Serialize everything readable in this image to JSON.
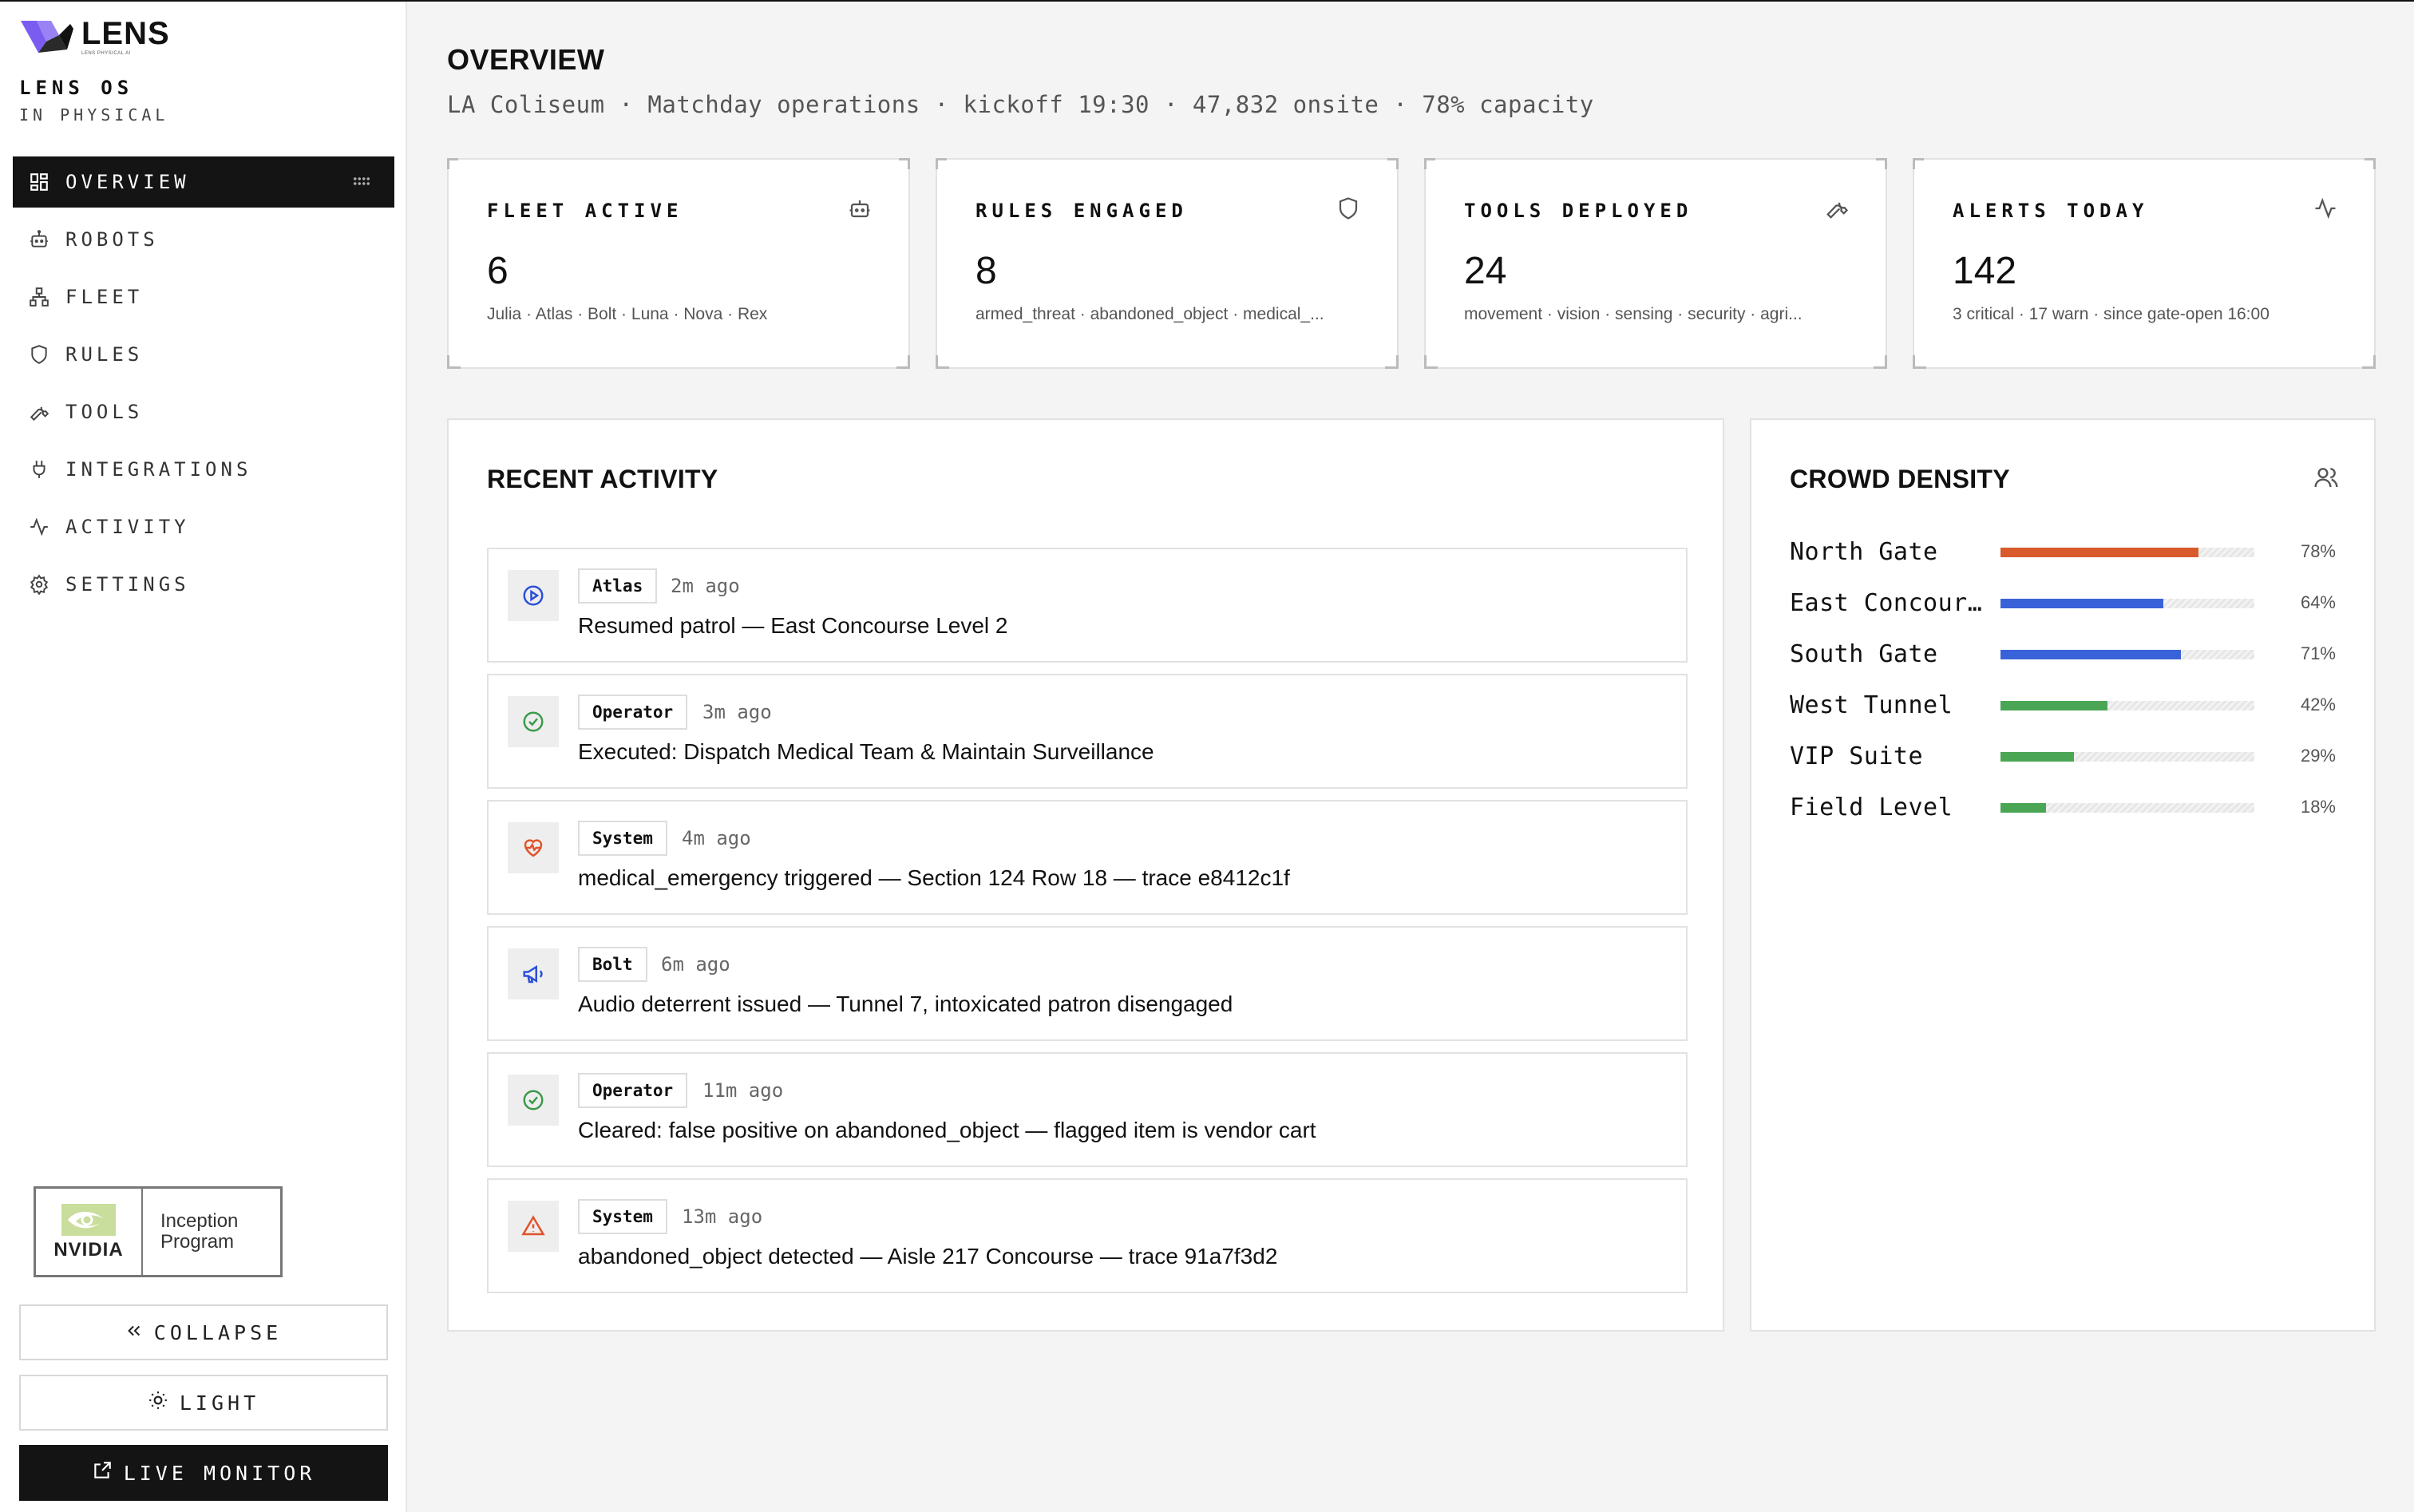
{
  "brand": {
    "logo_text": "LENS",
    "logo_sub": "LENS PHYSICAL AI",
    "os_title": "LENS OS",
    "os_sub": "IN PHYSICAL"
  },
  "nav": [
    {
      "label": "OVERVIEW",
      "icon": "layout-grid-icon",
      "active": true
    },
    {
      "label": "ROBOTS",
      "icon": "robot-icon"
    },
    {
      "label": "FLEET",
      "icon": "network-icon"
    },
    {
      "label": "RULES",
      "icon": "shield-icon"
    },
    {
      "label": "TOOLS",
      "icon": "wrench-icon"
    },
    {
      "label": "INTEGRATIONS",
      "icon": "plug-icon"
    },
    {
      "label": "ACTIVITY",
      "icon": "activity-icon"
    },
    {
      "label": "SETTINGS",
      "icon": "gear-icon"
    }
  ],
  "partner": {
    "name": "NVIDIA",
    "program_line1": "Inception",
    "program_line2": "Program"
  },
  "sidebar_buttons": {
    "collapse": "COLLAPSE",
    "theme": "LIGHT",
    "live_monitor": "LIVE MONITOR"
  },
  "header": {
    "title": "OVERVIEW",
    "subtitle": "LA Coliseum · Matchday operations · kickoff 19:30 · 47,832 onsite · 78% capacity"
  },
  "stats": [
    {
      "label": "FLEET ACTIVE",
      "value": "6",
      "detail": "Julia · Atlas · Bolt · Luna · Nova · Rex",
      "icon": "robot-icon"
    },
    {
      "label": "RULES ENGAGED",
      "value": "8",
      "detail": "armed_threat · abandoned_object · medical_...",
      "icon": "shield-icon"
    },
    {
      "label": "TOOLS DEPLOYED",
      "value": "24",
      "detail": "movement · vision · sensing · security · agri...",
      "icon": "wrench-icon"
    },
    {
      "label": "ALERTS TODAY",
      "value": "142",
      "detail": "3 critical · 17 warn · since gate-open 16:00",
      "icon": "activity-icon"
    }
  ],
  "recent_activity": {
    "title": "RECENT ACTIVITY",
    "items": [
      {
        "actor": "Atlas",
        "time": "2m ago",
        "text": "Resumed patrol — East Concourse Level 2",
        "icon": "play-circle-icon",
        "color": "#2c4fd6"
      },
      {
        "actor": "Operator",
        "time": "3m ago",
        "text": "Executed: Dispatch Medical Team & Maintain Surveillance",
        "icon": "check-circle-icon",
        "color": "#3b9a4a"
      },
      {
        "actor": "System",
        "time": "4m ago",
        "text": "medical_emergency triggered — Section 124 Row 18 — trace e8412c1f",
        "icon": "heart-pulse-icon",
        "color": "#e0532a"
      },
      {
        "actor": "Bolt",
        "time": "6m ago",
        "text": "Audio deterrent issued — Tunnel 7, intoxicated patron disengaged",
        "icon": "megaphone-icon",
        "color": "#2c4fd6"
      },
      {
        "actor": "Operator",
        "time": "11m ago",
        "text": "Cleared: false positive on abandoned_object — flagged item is vendor cart",
        "icon": "check-circle-icon",
        "color": "#3b9a4a"
      },
      {
        "actor": "System",
        "time": "13m ago",
        "text": "abandoned_object detected — Aisle 217 Concourse — trace 91a7f3d2",
        "icon": "warning-triangle-icon",
        "color": "#e0532a"
      }
    ]
  },
  "crowd_density": {
    "title": "CROWD DENSITY",
    "icon": "users-icon",
    "zones": [
      {
        "name": "North Gate",
        "percent": 78,
        "label": "78%",
        "color": "#d95a2b"
      },
      {
        "name": "East Concourse",
        "percent": 64,
        "label": "64%",
        "color": "#3a62d8"
      },
      {
        "name": "South Gate",
        "percent": 71,
        "label": "71%",
        "color": "#3a62d8"
      },
      {
        "name": "West Tunnel",
        "percent": 42,
        "label": "42%",
        "color": "#4aa655"
      },
      {
        "name": "VIP Suite",
        "percent": 29,
        "label": "29%",
        "color": "#4aa655"
      },
      {
        "name": "Field Level",
        "percent": 18,
        "label": "18%",
        "color": "#4aa655"
      }
    ]
  }
}
